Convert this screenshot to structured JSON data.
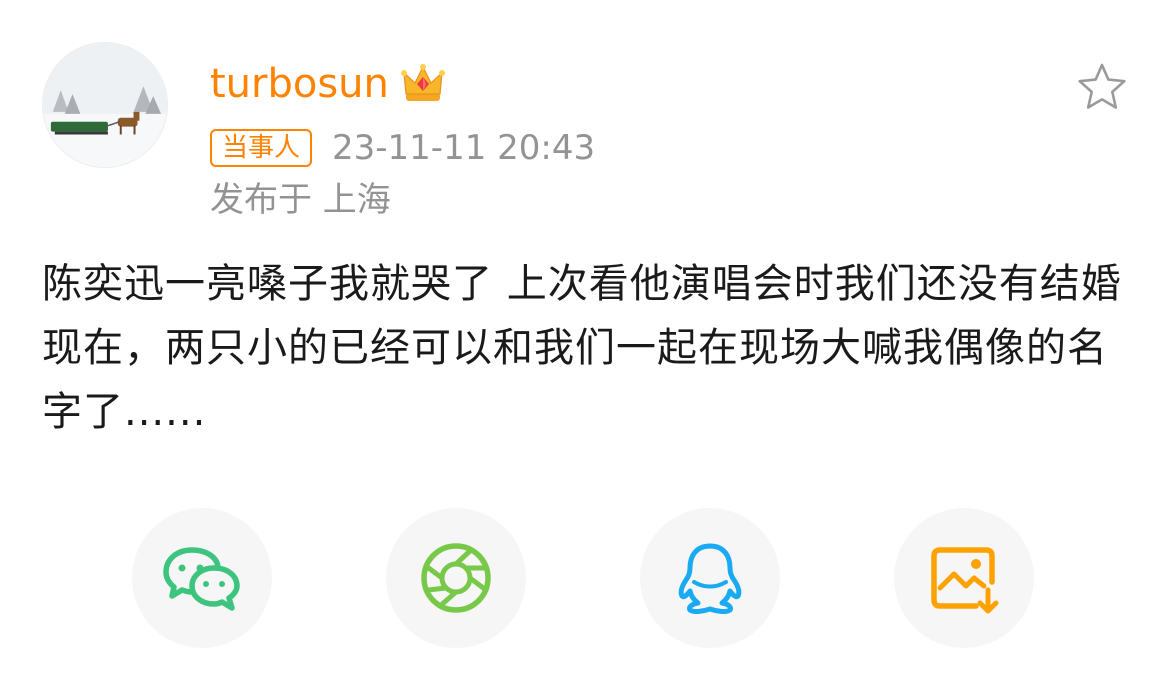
{
  "user": {
    "name": "turbosun",
    "role_badge": "当事人"
  },
  "post": {
    "timestamp": "23-11-11 20:43",
    "location": "发布于 上海",
    "content": "陈奕迅一亮嗓子我就哭了 上次看他演唱会时我们还没有结婚 现在，两只小的已经可以和我们一起在现场大喊我偶像的名字了......"
  },
  "icons": {
    "favorite": "star-outline-icon",
    "vip": "crown-icon"
  },
  "share": [
    {
      "name": "wechat-icon",
      "color": "#3dc47e"
    },
    {
      "name": "moments-icon",
      "color": "#78c84a"
    },
    {
      "name": "qq-icon",
      "color": "#1aaaf2"
    },
    {
      "name": "save-image-icon",
      "color": "#ffa200"
    }
  ],
  "colors": {
    "accent": "#ff8200",
    "meta": "#939393",
    "text": "#1a1a1a",
    "share_bg": "#f6f6f6"
  }
}
